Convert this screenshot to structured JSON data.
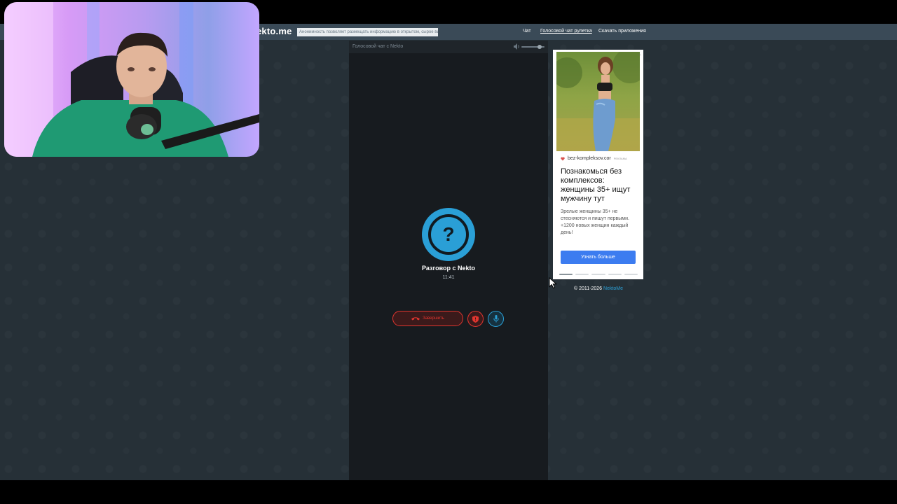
{
  "header": {
    "logo": "ekto.me",
    "notice": "Анонимность позволяет размещать информацию в открытом, сырое видео",
    "nav": [
      "Чат",
      "Голосовой чат рулетка",
      "Скачать приложения"
    ]
  },
  "chat": {
    "title": "Голосовой чат с Nekto",
    "conversation_title": "Разговор с Nekto",
    "timer": "11:41",
    "end_button": "Завершить",
    "volume_level": 0.8,
    "avatar_symbol": "?"
  },
  "ad": {
    "menu": "...",
    "domain": "bez-kompleksov.cor",
    "tag": "РЕКЛАМА",
    "headline": "Познакомься без комплексов: женщины 35+ ищут мужчину тут",
    "body": "Зрелые женщины 35+ не стесняются и пишут первыми. +1200 новых женщин каждый день!",
    "cta": "Узнать больше",
    "slides": 5,
    "active_slide": 1
  },
  "footer": {
    "copyright": "© 2011-2026",
    "link": "NektoMe"
  },
  "colors": {
    "accent_blue": "#2a9fd6",
    "danger_red": "#e0352f",
    "page_bg": "#263037",
    "panel_bg": "#171b1f",
    "cta_blue": "#3c7cf0"
  }
}
